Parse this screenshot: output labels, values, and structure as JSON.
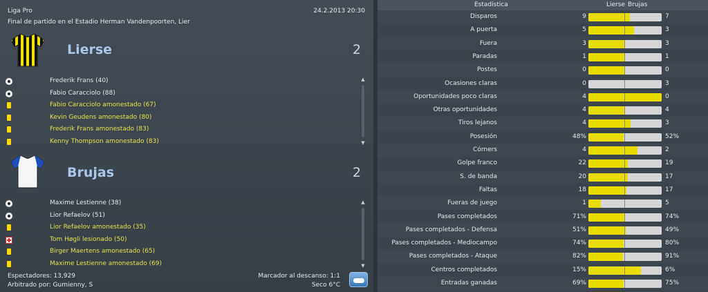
{
  "match": {
    "competition": "Liga Pro",
    "datetime": "24.2.2013 20:30",
    "venue": "Final de partido en el Estadio Herman Vandenpoorten, Lier"
  },
  "home": {
    "name": "Lierse",
    "score": "2",
    "events": [
      {
        "type": "goal",
        "icon": "ball-icon",
        "text": "Frederik Frans (40)"
      },
      {
        "type": "goal",
        "icon": "ball-icon",
        "text": "Fabio Caracciolo (88)"
      },
      {
        "type": "card",
        "icon": "yellow-card-icon",
        "text": "Fabio Caracciolo amonestado (67)"
      },
      {
        "type": "card",
        "icon": "yellow-card-icon",
        "text": "Kevin Geudens amonestado (80)"
      },
      {
        "type": "card",
        "icon": "yellow-card-icon",
        "text": "Frederik Frans amonestado (83)"
      },
      {
        "type": "card",
        "icon": "yellow-card-icon",
        "text": "Kenny Thompson amonestado (83)"
      }
    ]
  },
  "away": {
    "name": "Brujas",
    "score": "2",
    "events": [
      {
        "type": "goal",
        "icon": "ball-icon",
        "text": "Maxime Lestienne (38)"
      },
      {
        "type": "goal",
        "icon": "ball-icon",
        "text": "Lior Refaelov (51)"
      },
      {
        "type": "card",
        "icon": "yellow-card-icon",
        "text": "Lior Refaelov amonestado (35)"
      },
      {
        "type": "injury",
        "icon": "injury-cross-icon",
        "text": "Tom Høgli lesionado (50)"
      },
      {
        "type": "card",
        "icon": "yellow-card-icon",
        "text": "Birger Maertens amonestado (65)"
      },
      {
        "type": "card",
        "icon": "yellow-card-icon",
        "text": "Maxime Lestienne amonestado (69)"
      }
    ]
  },
  "footer": {
    "spectators": "Espectadores: 13,929",
    "referee": "Arbitrado por: Gumienny, S",
    "halftime": "Marcador al descanso: 1:1",
    "weather": "Seco 6°C",
    "weather_icon": "cloud-icon"
  },
  "stats": {
    "header": {
      "label": "Estadística",
      "home": "Lierse",
      "away": "Brujas"
    },
    "rows": [
      {
        "label": "Disparos",
        "home": "9",
        "away": "7",
        "home_share": 0.5625
      },
      {
        "label": "A puerta",
        "home": "5",
        "away": "3",
        "home_share": 0.625
      },
      {
        "label": "Fuera",
        "home": "3",
        "away": "3",
        "home_share": 0.5
      },
      {
        "label": "Paradas",
        "home": "1",
        "away": "1",
        "home_share": 0.5
      },
      {
        "label": "Postes",
        "home": "0",
        "away": "0",
        "home_share": 0.5
      },
      {
        "label": "Ocasiones claras",
        "home": "0",
        "away": "3",
        "home_share": 0.0
      },
      {
        "label": "Oportunidades poco claras",
        "home": "4",
        "away": "0",
        "home_share": 1.0
      },
      {
        "label": "Otras oportunidades",
        "home": "4",
        "away": "4",
        "home_share": 0.5
      },
      {
        "label": "Tiros lejanos",
        "home": "4",
        "away": "3",
        "home_share": 0.5714
      },
      {
        "label": "Posesión",
        "home": "48%",
        "away": "52%",
        "home_share": 0.48
      },
      {
        "label": "Córners",
        "home": "4",
        "away": "2",
        "home_share": 0.6667
      },
      {
        "label": "Golpe franco",
        "home": "22",
        "away": "19",
        "home_share": 0.5366
      },
      {
        "label": "S. de banda",
        "home": "20",
        "away": "17",
        "home_share": 0.5405
      },
      {
        "label": "Faltas",
        "home": "18",
        "away": "17",
        "home_share": 0.5143
      },
      {
        "label": "Fueras de juego",
        "home": "1",
        "away": "5",
        "home_share": 0.1667
      },
      {
        "label": "Pases completados",
        "home": "71%",
        "away": "74%",
        "home_share": 0.4897
      },
      {
        "label": "Pases completados - Defensa",
        "home": "51%",
        "away": "49%",
        "home_share": 0.51
      },
      {
        "label": "Pases completados - Mediocampo",
        "home": "74%",
        "away": "80%",
        "home_share": 0.4805
      },
      {
        "label": "Pases completados - Ataque",
        "home": "82%",
        "away": "91%",
        "home_share": 0.474
      },
      {
        "label": "Centros completados",
        "home": "15%",
        "away": "6%",
        "home_share": 0.7143
      },
      {
        "label": "Entradas ganadas",
        "home": "69%",
        "away": "75%",
        "home_share": 0.4792
      }
    ]
  },
  "colors": {
    "home_bar": "#e8dc00",
    "away_bar": "#d6d6d6",
    "team_name": "#a9c8e9",
    "event_highlight": "#e6e24f"
  }
}
